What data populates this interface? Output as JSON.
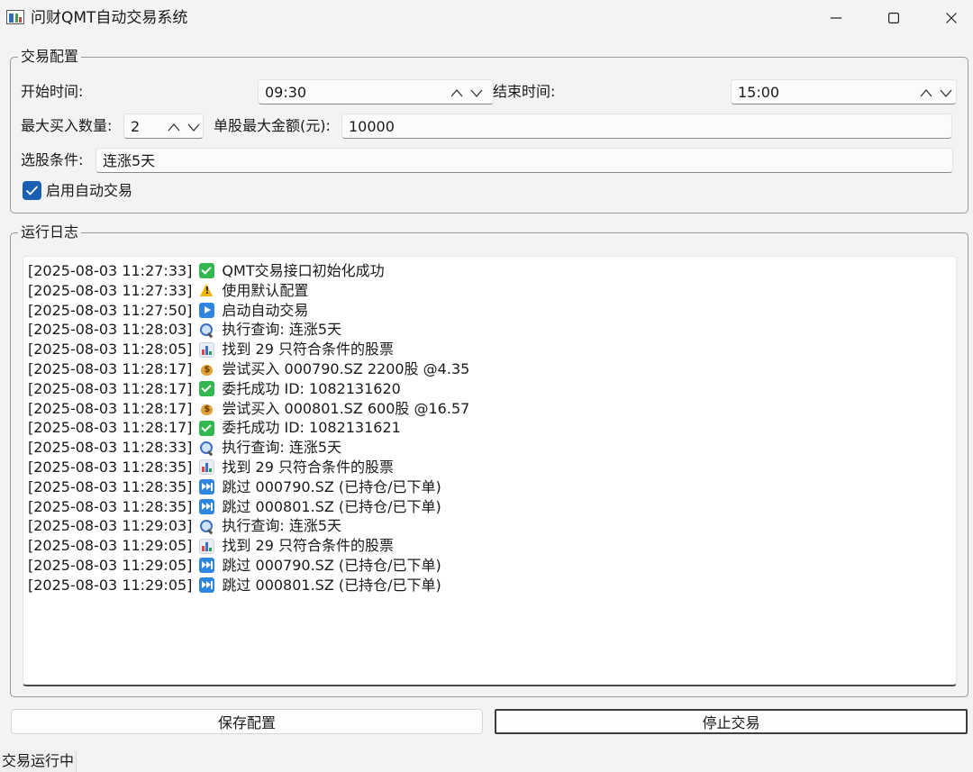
{
  "window": {
    "title": "问财QMT自动交易系统",
    "icon": "chart-app-icon",
    "controls": [
      "minimize-icon",
      "maximize-icon",
      "close-icon"
    ]
  },
  "config": {
    "group_title": "交易配置",
    "start_time_label": "开始时间:",
    "start_time_value": "09:30",
    "end_time_label": "结束时间:",
    "end_time_value": "15:00",
    "max_buy_label": "最大买入数量:",
    "max_buy_value": "2",
    "max_amount_label": "单股最大金额(元):",
    "max_amount_value": "10000",
    "condition_label": "选股条件:",
    "condition_value": "连涨5天",
    "auto_trade_label": "启用自动交易",
    "auto_trade_checked": true
  },
  "log": {
    "group_title": "运行日志",
    "entries": [
      {
        "time": "[2025-08-03 11:27:33]",
        "icon": "check-icon",
        "text": "QMT交易接口初始化成功"
      },
      {
        "time": "[2025-08-03 11:27:33]",
        "icon": "warning-icon",
        "text": "使用默认配置"
      },
      {
        "time": "[2025-08-03 11:27:50]",
        "icon": "play-icon",
        "text": "启动自动交易"
      },
      {
        "time": "[2025-08-03 11:28:03]",
        "icon": "search-icon",
        "text": "执行查询: 连涨5天"
      },
      {
        "time": "[2025-08-03 11:28:05]",
        "icon": "chart-icon",
        "text": "找到 29 只符合条件的股票"
      },
      {
        "time": "[2025-08-03 11:28:17]",
        "icon": "money-bag-icon",
        "text": "尝试买入 000790.SZ 2200股 @4.35"
      },
      {
        "time": "[2025-08-03 11:28:17]",
        "icon": "check-icon",
        "text": "委托成功 ID: 1082131620"
      },
      {
        "time": "[2025-08-03 11:28:17]",
        "icon": "money-bag-icon",
        "text": "尝试买入 000801.SZ 600股 @16.57"
      },
      {
        "time": "[2025-08-03 11:28:17]",
        "icon": "check-icon",
        "text": "委托成功 ID: 1082131621"
      },
      {
        "time": "[2025-08-03 11:28:33]",
        "icon": "search-icon",
        "text": "执行查询: 连涨5天"
      },
      {
        "time": "[2025-08-03 11:28:35]",
        "icon": "chart-icon",
        "text": "找到 29 只符合条件的股票"
      },
      {
        "time": "[2025-08-03 11:28:35]",
        "icon": "fast-forward-icon",
        "text": "跳过 000790.SZ (已持仓/已下单)"
      },
      {
        "time": "[2025-08-03 11:28:35]",
        "icon": "fast-forward-icon",
        "text": "跳过 000801.SZ (已持仓/已下单)"
      },
      {
        "time": "[2025-08-03 11:29:03]",
        "icon": "search-icon",
        "text": "执行查询: 连涨5天"
      },
      {
        "time": "[2025-08-03 11:29:05]",
        "icon": "chart-icon",
        "text": "找到 29 只符合条件的股票"
      },
      {
        "time": "[2025-08-03 11:29:05]",
        "icon": "fast-forward-icon",
        "text": "跳过 000790.SZ (已持仓/已下单)"
      },
      {
        "time": "[2025-08-03 11:29:05]",
        "icon": "fast-forward-icon",
        "text": "跳过 000801.SZ (已持仓/已下单)"
      }
    ]
  },
  "buttons": {
    "save_label": "保存配置",
    "stop_label": "停止交易"
  },
  "status": {
    "text": "交易运行中"
  },
  "colors": {
    "accent": "#1b5fb5",
    "window_bg": "#f3f3f3"
  }
}
